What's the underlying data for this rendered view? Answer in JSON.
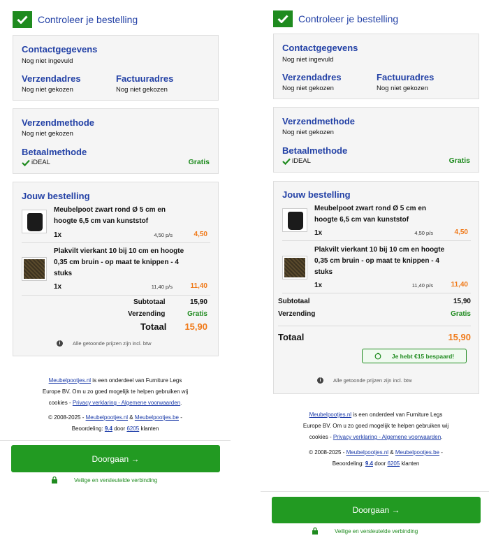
{
  "header": {
    "title": "Controleer je bestelling"
  },
  "contact": {
    "title": "Contactgegevens",
    "value": "Nog niet ingevuld"
  },
  "shipping_address": {
    "title": "Verzendadres",
    "value": "Nog niet gekozen"
  },
  "billing_address": {
    "title": "Factuuradres",
    "value": "Nog niet gekozen"
  },
  "shipping_method": {
    "title": "Verzendmethode",
    "value": "Nog niet gekozen"
  },
  "payment_method": {
    "title": "Betaalmethode",
    "value": "iDEAL",
    "cost": "Gratis"
  },
  "order": {
    "title": "Jouw bestelling",
    "items": [
      {
        "name_line1": "Meubelpoot zwart rond Ø 5 cm en",
        "name_line2": "hoogte 6,5 cm van kunststof",
        "name_line3": "",
        "qty": "1x",
        "unit_price": "4,50 p/s",
        "price": "4,50"
      },
      {
        "name_line1": "Plakvilt vierkant 10 bij 10 cm en hoogte",
        "name_line2": "0,35 cm bruin - op maat te knippen - 4",
        "name_line3": "stuks",
        "qty": "1x",
        "unit_price": "11,40 p/s",
        "price": "11,40"
      }
    ],
    "subtotal_label": "Subtotaal",
    "subtotal": "15,90",
    "shipping_label": "Verzending",
    "shipping": "Gratis",
    "total_label": "Totaal",
    "total": "15,90",
    "savings": "Je hebt €15 bespaard!",
    "vat_note": "Alle getoonde prijzen zijn incl. btw"
  },
  "footer": {
    "site1": "Meubelpootjes.nl",
    "text1": " is een onderdeel van Furniture Legs",
    "text2": "Europe BV. Om u zo goed mogelijk te helpen gebruiken wij",
    "text3": "cookies - ",
    "policy_link": "Privacy verklaring - Algemene voorwaarden",
    "text4": ".",
    "copyright": "© 2008-2025 - ",
    "amp": " & ",
    "site2": "Meubelpootjes.be",
    "dash": " -",
    "rating_label": "Beoordeling: ",
    "rating": "9.4",
    "by": " door ",
    "count": "6205",
    "customers": " klanten"
  },
  "cta": {
    "label": "Doorgaan →"
  },
  "secure": {
    "label": "Veilige en versleutelde verbinding"
  },
  "colors": {
    "brand_blue": "#2442a6",
    "green": "#1f8b1f",
    "orange": "#f07a1a"
  }
}
